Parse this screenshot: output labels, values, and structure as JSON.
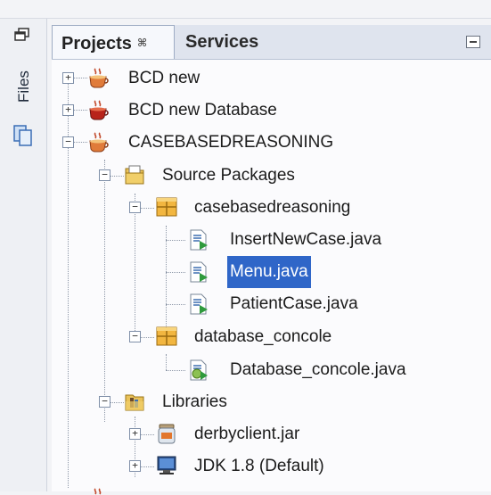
{
  "sidebar": {
    "files_label": "Files"
  },
  "tabs": {
    "projects_label": "Projects",
    "projects_close": "⌘",
    "services_label": "Services"
  },
  "tree": {
    "projects": [
      {
        "label": "BCD new",
        "expanded": false
      },
      {
        "label": "BCD new Database",
        "expanded": false
      },
      {
        "label": "CASEBASEDREASONING",
        "expanded": true
      }
    ],
    "source_packages": "Source Packages",
    "packages": [
      {
        "label": "casebasedreasoning",
        "files": [
          "InsertNewCase.java",
          "Menu.java",
          "PatientCase.java"
        ],
        "selected": "Menu.java"
      },
      {
        "label": "database_concole",
        "files": [
          "Database_concole.java"
        ]
      }
    ],
    "libraries": "Libraries",
    "library_items": [
      "derbyclient.jar",
      "JDK 1.8 (Default)"
    ]
  },
  "colors": {
    "selection": "#2f66c8",
    "tab_active": "#f6f8fc",
    "tab_bar": "#dfe4ee"
  }
}
